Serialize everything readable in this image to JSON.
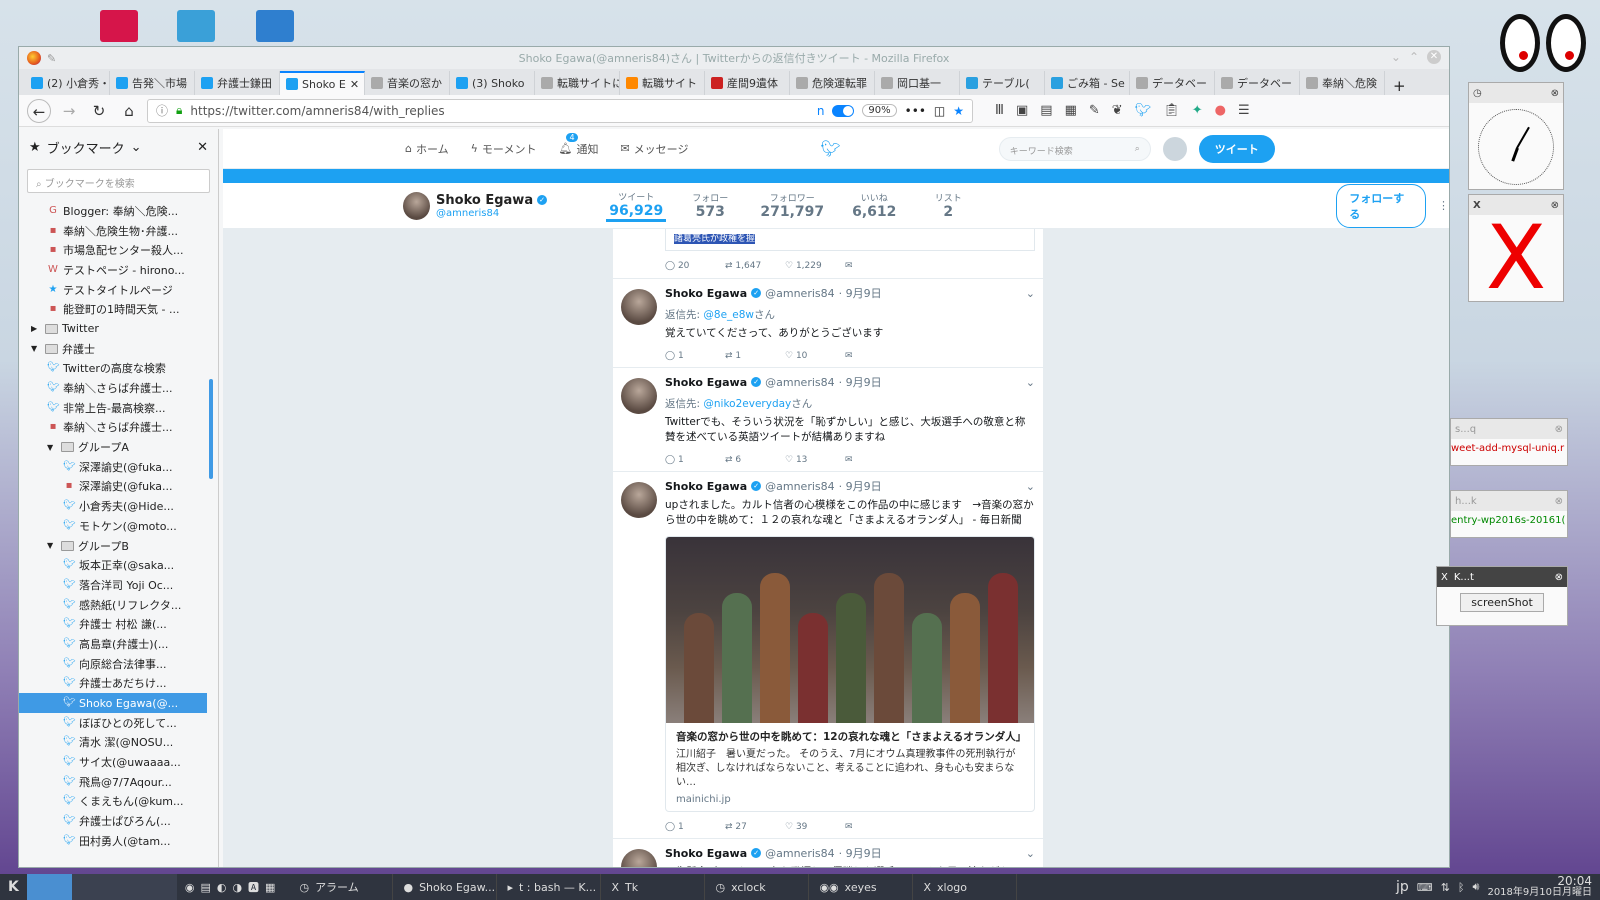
{
  "window": {
    "title": "Shoko Egawa(@amneris84)さん | Twitterからの返信付きツイート - Mozilla Firefox"
  },
  "tabs": [
    {
      "label": "(2) 小倉秀・",
      "icon": "twitter-icon"
    },
    {
      "label": "告発＼市場",
      "icon": "twitter-icon"
    },
    {
      "label": "弁護士鎌田",
      "icon": "twitter-icon"
    },
    {
      "label": "Shoko E",
      "icon": "twitter-icon",
      "active": true
    },
    {
      "label": "音楽の窓か",
      "icon": "blog-icon"
    },
    {
      "label": "(3) Shoko",
      "icon": "twitter-icon"
    },
    {
      "label": "転職サイトにお",
      "icon": "blank-icon"
    },
    {
      "label": "転職サイト",
      "icon": "sun-icon"
    },
    {
      "label": "産間9遺体",
      "icon": "news-icon"
    },
    {
      "label": "危険運転罪",
      "icon": "yahoo-icon"
    },
    {
      "label": "岡口基一",
      "icon": "wiki-icon"
    },
    {
      "label": "テーブル(",
      "icon": "star-icon"
    },
    {
      "label": "ごみ箱 - Se",
      "icon": "star-icon"
    },
    {
      "label": "データベー",
      "icon": "blog-icon"
    },
    {
      "label": "データベー",
      "icon": "blog-icon"
    },
    {
      "label": "奉納＼危険",
      "icon": "blog-icon"
    }
  ],
  "navbar": {
    "url": "https://twitter.com/amneris84/with_replies",
    "zoom": "90%",
    "n": "n"
  },
  "sidebar": {
    "title": "ブックマーク",
    "search_placeholder": "ブックマークを検索",
    "items": [
      {
        "label": "Blogger: 奉納＼危険...",
        "indent": 2,
        "icon": "G"
      },
      {
        "label": "奉納＼危険生物･弁護...",
        "indent": 2,
        "icon": "blog"
      },
      {
        "label": "市場急配センター殺人...",
        "indent": 2,
        "icon": "blog"
      },
      {
        "label": "テストページ - hirono...",
        "indent": 2,
        "icon": "W"
      },
      {
        "label": "テストタイトルページ",
        "indent": 2,
        "icon": "star"
      },
      {
        "label": "能登町の1時間天気 - ...",
        "indent": 2,
        "icon": "cube"
      },
      {
        "label": "Twitter",
        "indent": 1,
        "folder": true,
        "open": false
      },
      {
        "label": "弁護士",
        "indent": 1,
        "folder": true,
        "open": true
      },
      {
        "label": "Twitterの高度な検索",
        "indent": 2,
        "icon": "tw"
      },
      {
        "label": "奉納＼さらば弁護士...",
        "indent": 2,
        "icon": "tw"
      },
      {
        "label": "非常上告-最高検察...",
        "indent": 2,
        "icon": "tw"
      },
      {
        "label": "奉納＼さらば弁護士...",
        "indent": 2,
        "icon": "blog"
      },
      {
        "label": "グループA",
        "indent": 2,
        "folder": true,
        "open": true
      },
      {
        "label": "深澤諭史(@fuka...",
        "indent": 3,
        "icon": "tw"
      },
      {
        "label": "深澤諭史(@fuka...",
        "indent": 3,
        "icon": "blog"
      },
      {
        "label": "小倉秀夫(@Hide...",
        "indent": 3,
        "icon": "tw"
      },
      {
        "label": "モトケン(@moto...",
        "indent": 3,
        "icon": "tw"
      },
      {
        "label": "グループB",
        "indent": 2,
        "folder": true,
        "open": true
      },
      {
        "label": "坂本正幸(@saka...",
        "indent": 3,
        "icon": "tw"
      },
      {
        "label": "落合洋司 Yoji Oc...",
        "indent": 3,
        "icon": "tw"
      },
      {
        "label": "感熱紙(リフレクタ...",
        "indent": 3,
        "icon": "tw"
      },
      {
        "label": "弁護士 村松 謙(...",
        "indent": 3,
        "icon": "tw"
      },
      {
        "label": "高島章(弁護士)(...",
        "indent": 3,
        "icon": "tw"
      },
      {
        "label": "向原総合法律事...",
        "indent": 3,
        "icon": "tw"
      },
      {
        "label": "弁護士あだちけ...",
        "indent": 3,
        "icon": "tw"
      },
      {
        "label": "Shoko Egawa(@...",
        "indent": 3,
        "icon": "tw",
        "selected": true
      },
      {
        "label": "ぼぼひとの死して...",
        "indent": 3,
        "icon": "tw"
      },
      {
        "label": "清水 潔(@NOSU...",
        "indent": 3,
        "icon": "tw"
      },
      {
        "label": "サイ太(@uwaaaa...",
        "indent": 3,
        "icon": "tw"
      },
      {
        "label": "飛鳥@7/7Aqour...",
        "indent": 3,
        "icon": "tw"
      },
      {
        "label": "くまえもん(@kum...",
        "indent": 3,
        "icon": "tw"
      },
      {
        "label": "弁護士ぱびろん(...",
        "indent": 3,
        "icon": "tw"
      },
      {
        "label": "田村勇人(@tam...",
        "indent": 3,
        "icon": "tw"
      }
    ]
  },
  "twitter": {
    "nav": {
      "home": "ホーム",
      "moments": "モーメント",
      "notifications": "通知",
      "notif_count": "4",
      "messages": "メッセージ",
      "search_placeholder": "キーワード検索",
      "tweet_btn": "ツイート"
    },
    "profile": {
      "name": "Shoko Egawa",
      "handle": "@amneris84",
      "follow_btn": "フォローする"
    },
    "stats": [
      {
        "label": "ツイート",
        "value": "96,929",
        "active": true
      },
      {
        "label": "フォロー",
        "value": "573"
      },
      {
        "label": "フォロワー",
        "value": "271,797"
      },
      {
        "label": "いいね",
        "value": "6,612"
      },
      {
        "label": "リスト",
        "value": "2"
      }
    ],
    "top_partial": {
      "highlight": "諸葛亮氏が政権を握",
      "replies": "20",
      "retweets": "1,647",
      "likes": "1,229"
    },
    "tweets": [
      {
        "name": "Shoko Egawa",
        "handle": "@amneris84",
        "date": "· 9月9日",
        "reply_prefix": "返信先:",
        "reply_to": "@8e_e8w",
        "reply_suffix": "さん",
        "text": "覚えていてくださって、ありがとうございます",
        "replies": "1",
        "retweets": "1",
        "likes": "10"
      },
      {
        "name": "Shoko Egawa",
        "handle": "@amneris84",
        "date": "· 9月9日",
        "reply_prefix": "返信先:",
        "reply_to": "@niko2everyday",
        "reply_suffix": "さん",
        "text": "Twitterでも、そういう状況を「恥ずかしい」と感じ、大坂選手への敬意と称賛を述べている英語ツイートが結構ありますね",
        "replies": "1",
        "retweets": "6",
        "likes": "13"
      },
      {
        "name": "Shoko Egawa",
        "handle": "@amneris84",
        "date": "· 9月9日",
        "text": "upされました。カルト信者の心模様をこの作品の中に感じます　→音楽の窓から世の中を眺めて：１２の哀れな魂と「さまよえるオランダ人」 - 毎日新聞",
        "card_title": "音楽の窓から世の中を眺めて：12の哀れな魂と「さまよえるオランダ人」",
        "card_desc": "江川紹子　暑い夏だった。 そのうえ、7月にオウム真理教事件の死刑執行が相次ぎ、しなければならないこと、考えることに追われ、身も心も安まらない…",
        "card_domain": "mainichi.jp",
        "replies": "1",
        "retweets": "27",
        "likes": "39"
      },
      {
        "name": "Shoko Egawa",
        "handle": "@amneris84",
        "date": "· 9月9日",
        "text": "一生懸命プレーして、力を発揮して優勝した選手に、こんな風に涙ながらの"
      }
    ]
  },
  "widgets": {
    "small1": {
      "title": "s...q",
      "text": "weet-add-mysql-uniq.r"
    },
    "small2": {
      "title": "h...k",
      "text": "entry-wp2016s-20161("
    },
    "kt": {
      "title": "K...t",
      "button": "screenShot"
    }
  },
  "taskbar": {
    "items": [
      {
        "label": "アラーム",
        "icon": "clock-icon"
      },
      {
        "label": "Shoko Egaw...",
        "icon": "firefox-icon"
      },
      {
        "label": "t : bash — K...",
        "icon": "terminal-icon"
      },
      {
        "label": "Tk",
        "icon": "x-icon"
      },
      {
        "label": "xclock",
        "icon": "clock-icon"
      },
      {
        "label": "xeyes",
        "icon": "eyes-icon"
      },
      {
        "label": "xlogo",
        "icon": "x-icon"
      }
    ],
    "ime": "jp",
    "time": "20:04",
    "date": "2018年9月10日月曜日"
  }
}
